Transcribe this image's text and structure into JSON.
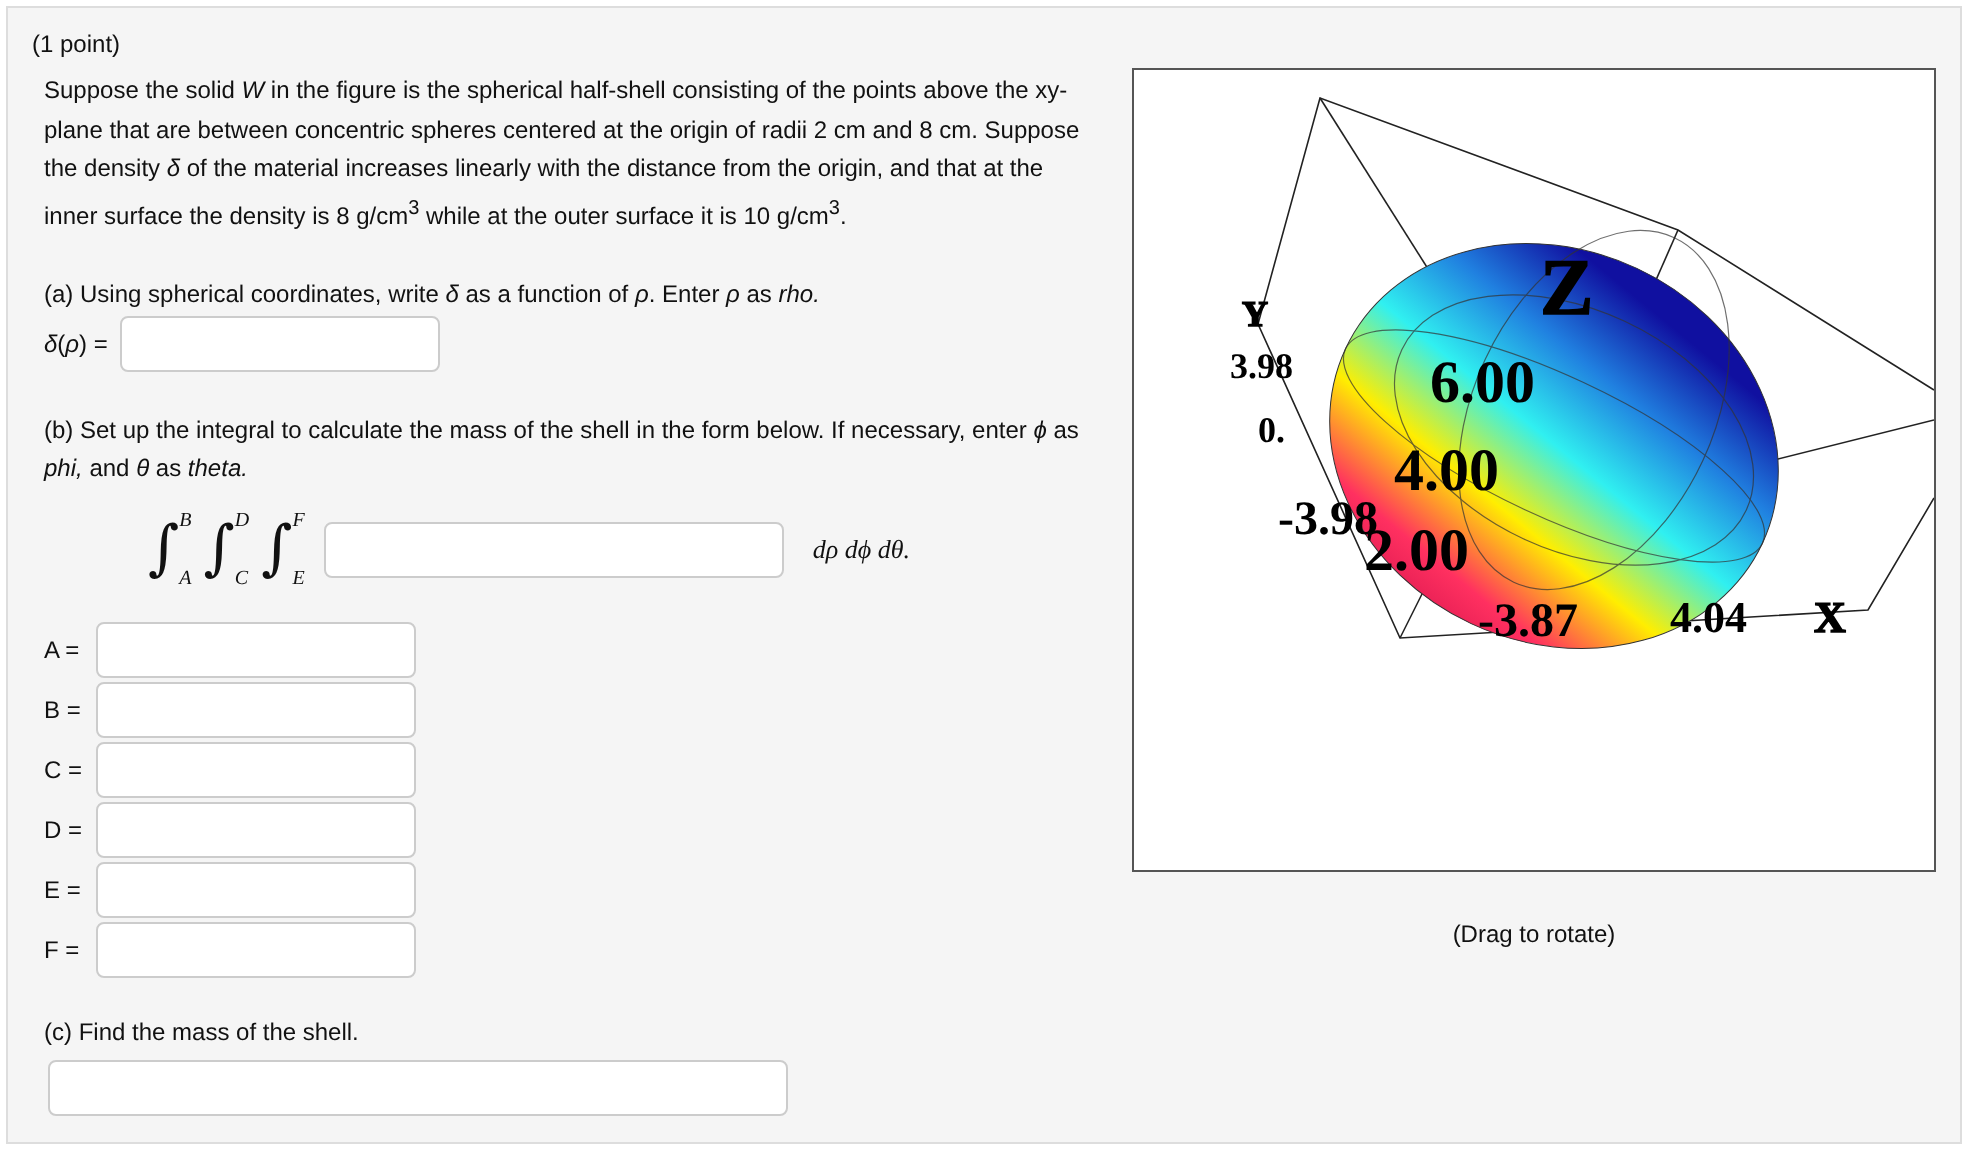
{
  "points": "(1 point)",
  "intro": "Suppose the solid *W* in the figure is the spherical half-shell consisting of the points above the xy-plane that are between concentric spheres centered at the origin of radii 2 cm and 8 cm. Suppose the density *δ* of the material increases linearly with the distance from the origin, and that at the inner surface the density is 8 g/cm$^{3}$ while at the outer surface it is 10 g/cm$^{3}$.",
  "part_a": {
    "prompt": "(a) Using spherical coordinates, write *δ* as a function of *ρ*. Enter *ρ* as *rho.*",
    "label": "*δ*(*ρ*) ="
  },
  "part_b": {
    "prompt": "(b) Set up the integral to calculate the mass of the shell in the form below. If necessary, enter *ϕ* as *phi,* and *θ* as *theta.*",
    "integrals": [
      {
        "sign": "∫",
        "upper": "B",
        "lower": "A"
      },
      {
        "sign": "∫",
        "upper": "D",
        "lower": "C"
      },
      {
        "sign": "∫",
        "upper": "F",
        "lower": "E"
      }
    ],
    "differentials": "dρ dϕ dθ.",
    "limits": [
      {
        "label": "A ="
      },
      {
        "label": "B ="
      },
      {
        "label": "C ="
      },
      {
        "label": "D ="
      },
      {
        "label": "E ="
      },
      {
        "label": "F ="
      }
    ]
  },
  "part_c": {
    "prompt": "(c) Find the mass of the shell."
  },
  "plot": {
    "labels": [
      {
        "kind": "axis",
        "text": "Z"
      },
      {
        "kind": "axis",
        "text": "Y"
      },
      {
        "kind": "tick",
        "text": "3.98"
      },
      {
        "kind": "tick",
        "text": "0."
      },
      {
        "kind": "tick",
        "text": "6.00"
      },
      {
        "kind": "tick",
        "text": "4.00"
      },
      {
        "kind": "tick",
        "text": "-3.98"
      },
      {
        "kind": "tick",
        "text": "2.00"
      },
      {
        "kind": "tick",
        "text": "-3.87"
      },
      {
        "kind": "tick",
        "text": "4.04"
      },
      {
        "kind": "axis",
        "text": "X"
      }
    ],
    "caption": "(Drag to rotate)"
  }
}
